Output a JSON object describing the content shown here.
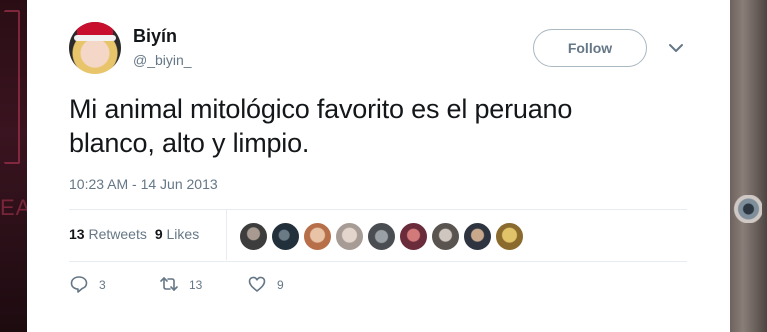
{
  "tweet": {
    "author_name": "Biyín",
    "author_handle": "@_biyin_",
    "follow_label": "Follow",
    "text_line1": "Mi animal mitológico favorito es el peruano",
    "text_line2": "blanco, alto y limpio.",
    "timestamp": "10:23 AM - 14 Jun 2013"
  },
  "stats": {
    "retweets_count": "13",
    "retweets_label": "Retweets",
    "likes_count": "9",
    "likes_label": "Likes"
  },
  "actions": {
    "reply_count": "3",
    "retweet_count": "13",
    "like_count": "9"
  },
  "colors": {
    "text_primary": "#14171a",
    "text_secondary": "#657786",
    "border": "#e6ecf0"
  },
  "background": {
    "left_sign_text": "EA"
  }
}
